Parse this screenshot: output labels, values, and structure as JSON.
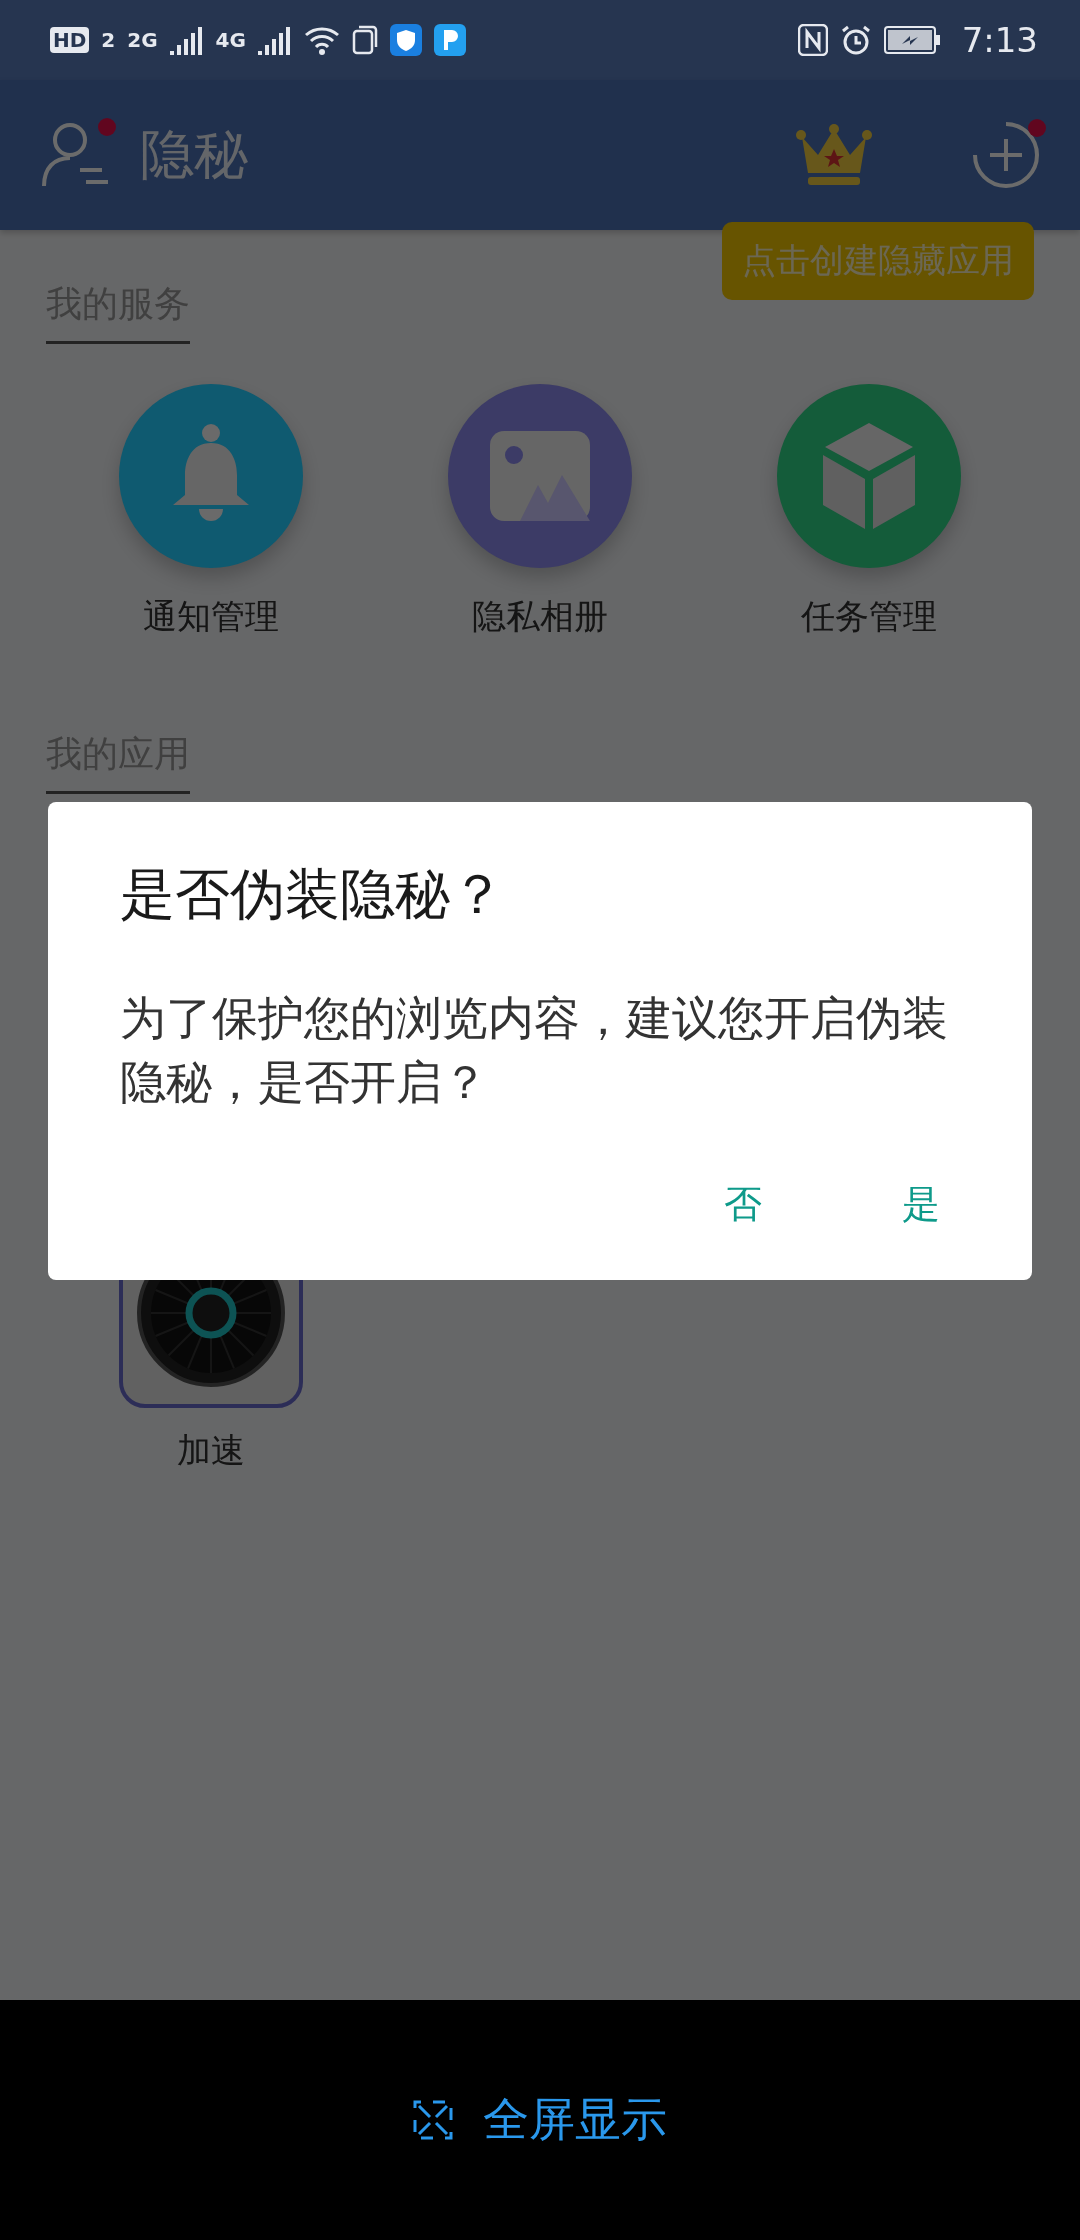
{
  "status_bar": {
    "hd": "HD",
    "sim": "2",
    "networks": [
      "2G",
      "4G"
    ],
    "time": "7:13"
  },
  "header": {
    "title": "隐秘",
    "profile_badge": true,
    "add_badge": true
  },
  "hint_tag": "点击创建隐藏应用",
  "services": {
    "title": "我的服务",
    "items": [
      {
        "label": "通知管理",
        "kind": "bell",
        "color": "#0f5a70"
      },
      {
        "label": "隐私相册",
        "kind": "picture",
        "color": "#3c3b66"
      },
      {
        "label": "任务管理",
        "kind": "cube",
        "color": "#145c3a"
      }
    ]
  },
  "apps": {
    "title": "我的应用",
    "items": [
      {
        "label": "加速",
        "kind": "turbine"
      }
    ]
  },
  "dialog": {
    "title": "是否伪装隐秘？",
    "message": "为了保护您的浏览内容，建议您开启伪装隐秘，是否开启？",
    "buttons": [
      "否",
      "是"
    ]
  },
  "bottom_bar": {
    "label": "全屏显示"
  }
}
